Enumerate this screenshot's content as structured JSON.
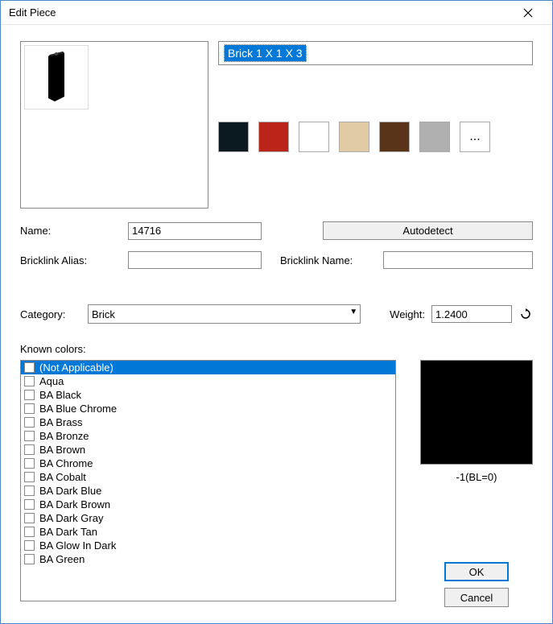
{
  "window": {
    "title": "Edit Piece"
  },
  "description": {
    "value": "Brick 1 X 1 X 3"
  },
  "palette": [
    {
      "name": "black",
      "hex": "#0b1a21"
    },
    {
      "name": "red",
      "hex": "#bb2418"
    },
    {
      "name": "white",
      "hex": "#ffffff"
    },
    {
      "name": "tan",
      "hex": "#e0cba4"
    },
    {
      "name": "brown",
      "hex": "#5a3419"
    },
    {
      "name": "gray",
      "hex": "#b0b0b0"
    },
    {
      "name": "more",
      "hex": "#ffffff",
      "label": "..."
    }
  ],
  "form": {
    "name_label": "Name:",
    "name_value": "14716",
    "autodetect_label": "Autodetect",
    "bl_alias_label": "Bricklink Alias:",
    "bl_alias_value": "",
    "bl_name_label": "Bricklink Name:",
    "bl_name_value": "",
    "category_label": "Category:",
    "category_value": "Brick",
    "weight_label": "Weight:",
    "weight_value": "1.2400"
  },
  "known_colors_label": "Known colors:",
  "known_colors": [
    {
      "label": "(Not Applicable)",
      "selected": true
    },
    {
      "label": "Aqua"
    },
    {
      "label": "BA Black"
    },
    {
      "label": "BA Blue Chrome"
    },
    {
      "label": "BA Brass"
    },
    {
      "label": "BA Bronze"
    },
    {
      "label": "BA Brown"
    },
    {
      "label": "BA Chrome"
    },
    {
      "label": "BA Cobalt"
    },
    {
      "label": "BA Dark Blue"
    },
    {
      "label": "BA Dark Brown"
    },
    {
      "label": "BA Dark Gray"
    },
    {
      "label": "BA Dark Tan"
    },
    {
      "label": "BA Glow In Dark"
    },
    {
      "label": "BA Green"
    }
  ],
  "current_color": {
    "hex": "#000000",
    "label": "-1(BL=0)"
  },
  "buttons": {
    "ok": "OK",
    "cancel": "Cancel"
  }
}
